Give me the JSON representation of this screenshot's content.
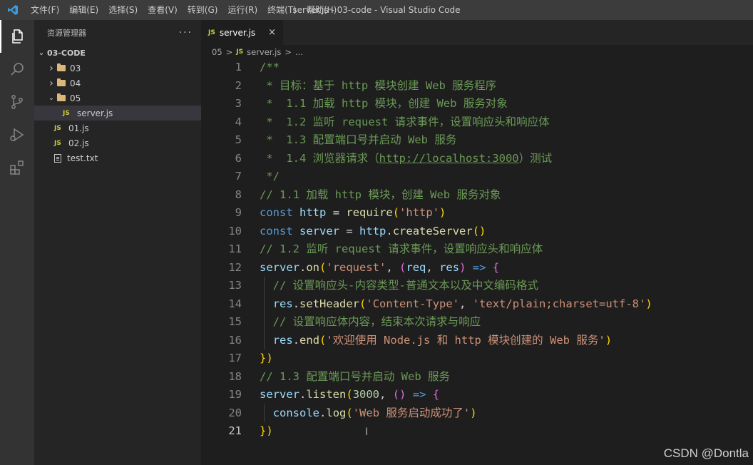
{
  "titlebar": {
    "menu": [
      "文件(F)",
      "编辑(E)",
      "选择(S)",
      "查看(V)",
      "转到(G)",
      "运行(R)",
      "终端(T)",
      "帮助(H)"
    ],
    "window_title": "server.js - 03-code - Visual Studio Code"
  },
  "activity_bar": {
    "icons": [
      "explorer-icon",
      "search-icon",
      "source-control-icon",
      "run-debug-icon",
      "extensions-icon"
    ]
  },
  "sidebar": {
    "title": "资源管理器",
    "more": "···",
    "root": "03-CODE",
    "items": [
      {
        "label": "03",
        "type": "folder",
        "state": "collapsed"
      },
      {
        "label": "04",
        "type": "folder",
        "state": "collapsed"
      },
      {
        "label": "05",
        "type": "folder",
        "state": "expanded"
      },
      {
        "label": "server.js",
        "type": "js",
        "selected": true
      },
      {
        "label": "01.js",
        "type": "js"
      },
      {
        "label": "02.js",
        "type": "js"
      },
      {
        "label": "test.txt",
        "type": "txt"
      }
    ]
  },
  "editor": {
    "tab": {
      "icon": "JS",
      "label": "server.js",
      "close": "×"
    },
    "breadcrumb": {
      "folder": "05",
      "sep": ">",
      "icon": "JS",
      "file": "server.js",
      "more": "..."
    },
    "current_line": 21,
    "lines": [
      "/**",
      " * 目标：基于 http 模块创建 Web 服务程序",
      " *  1.1 加载 http 模块，创建 Web 服务对象",
      " *  1.2 监听 request 请求事件，设置响应头和响应体",
      " *  1.3 配置端口号并启动 Web 服务",
      " *  1.4 浏览器请求（http://localhost:3000）测试",
      " */",
      "// 1.1 加载 http 模块，创建 Web 服务对象",
      "const http = require('http')",
      "const server = http.createServer()",
      "// 1.2 监听 request 请求事件，设置响应头和响应体",
      "server.on('request', (req, res) => {",
      "  // 设置响应头-内容类型-普通文本以及中文编码格式",
      "  res.setHeader('Content-Type', 'text/plain;charset=utf-8')",
      "  // 设置响应体内容，结束本次请求与响应",
      "  res.end('欢迎使用 Node.js 和 http 模块创建的 Web 服务')",
      "})",
      "// 1.3 配置端口号并启动 Web 服务",
      "server.listen(3000, () => {",
      "  console.log('Web 服务启动成功了')",
      "})"
    ]
  },
  "watermark": "CSDN @Dontla",
  "colors": {
    "comment": "#6a9955",
    "keyword": "#569cd6",
    "variable": "#9cdcfe",
    "function": "#dcdcaa",
    "string": "#ce9178",
    "number": "#b5cea8",
    "bracket1": "#ffd700",
    "bracket2": "#da70d6",
    "bracket3": "#179fff"
  }
}
